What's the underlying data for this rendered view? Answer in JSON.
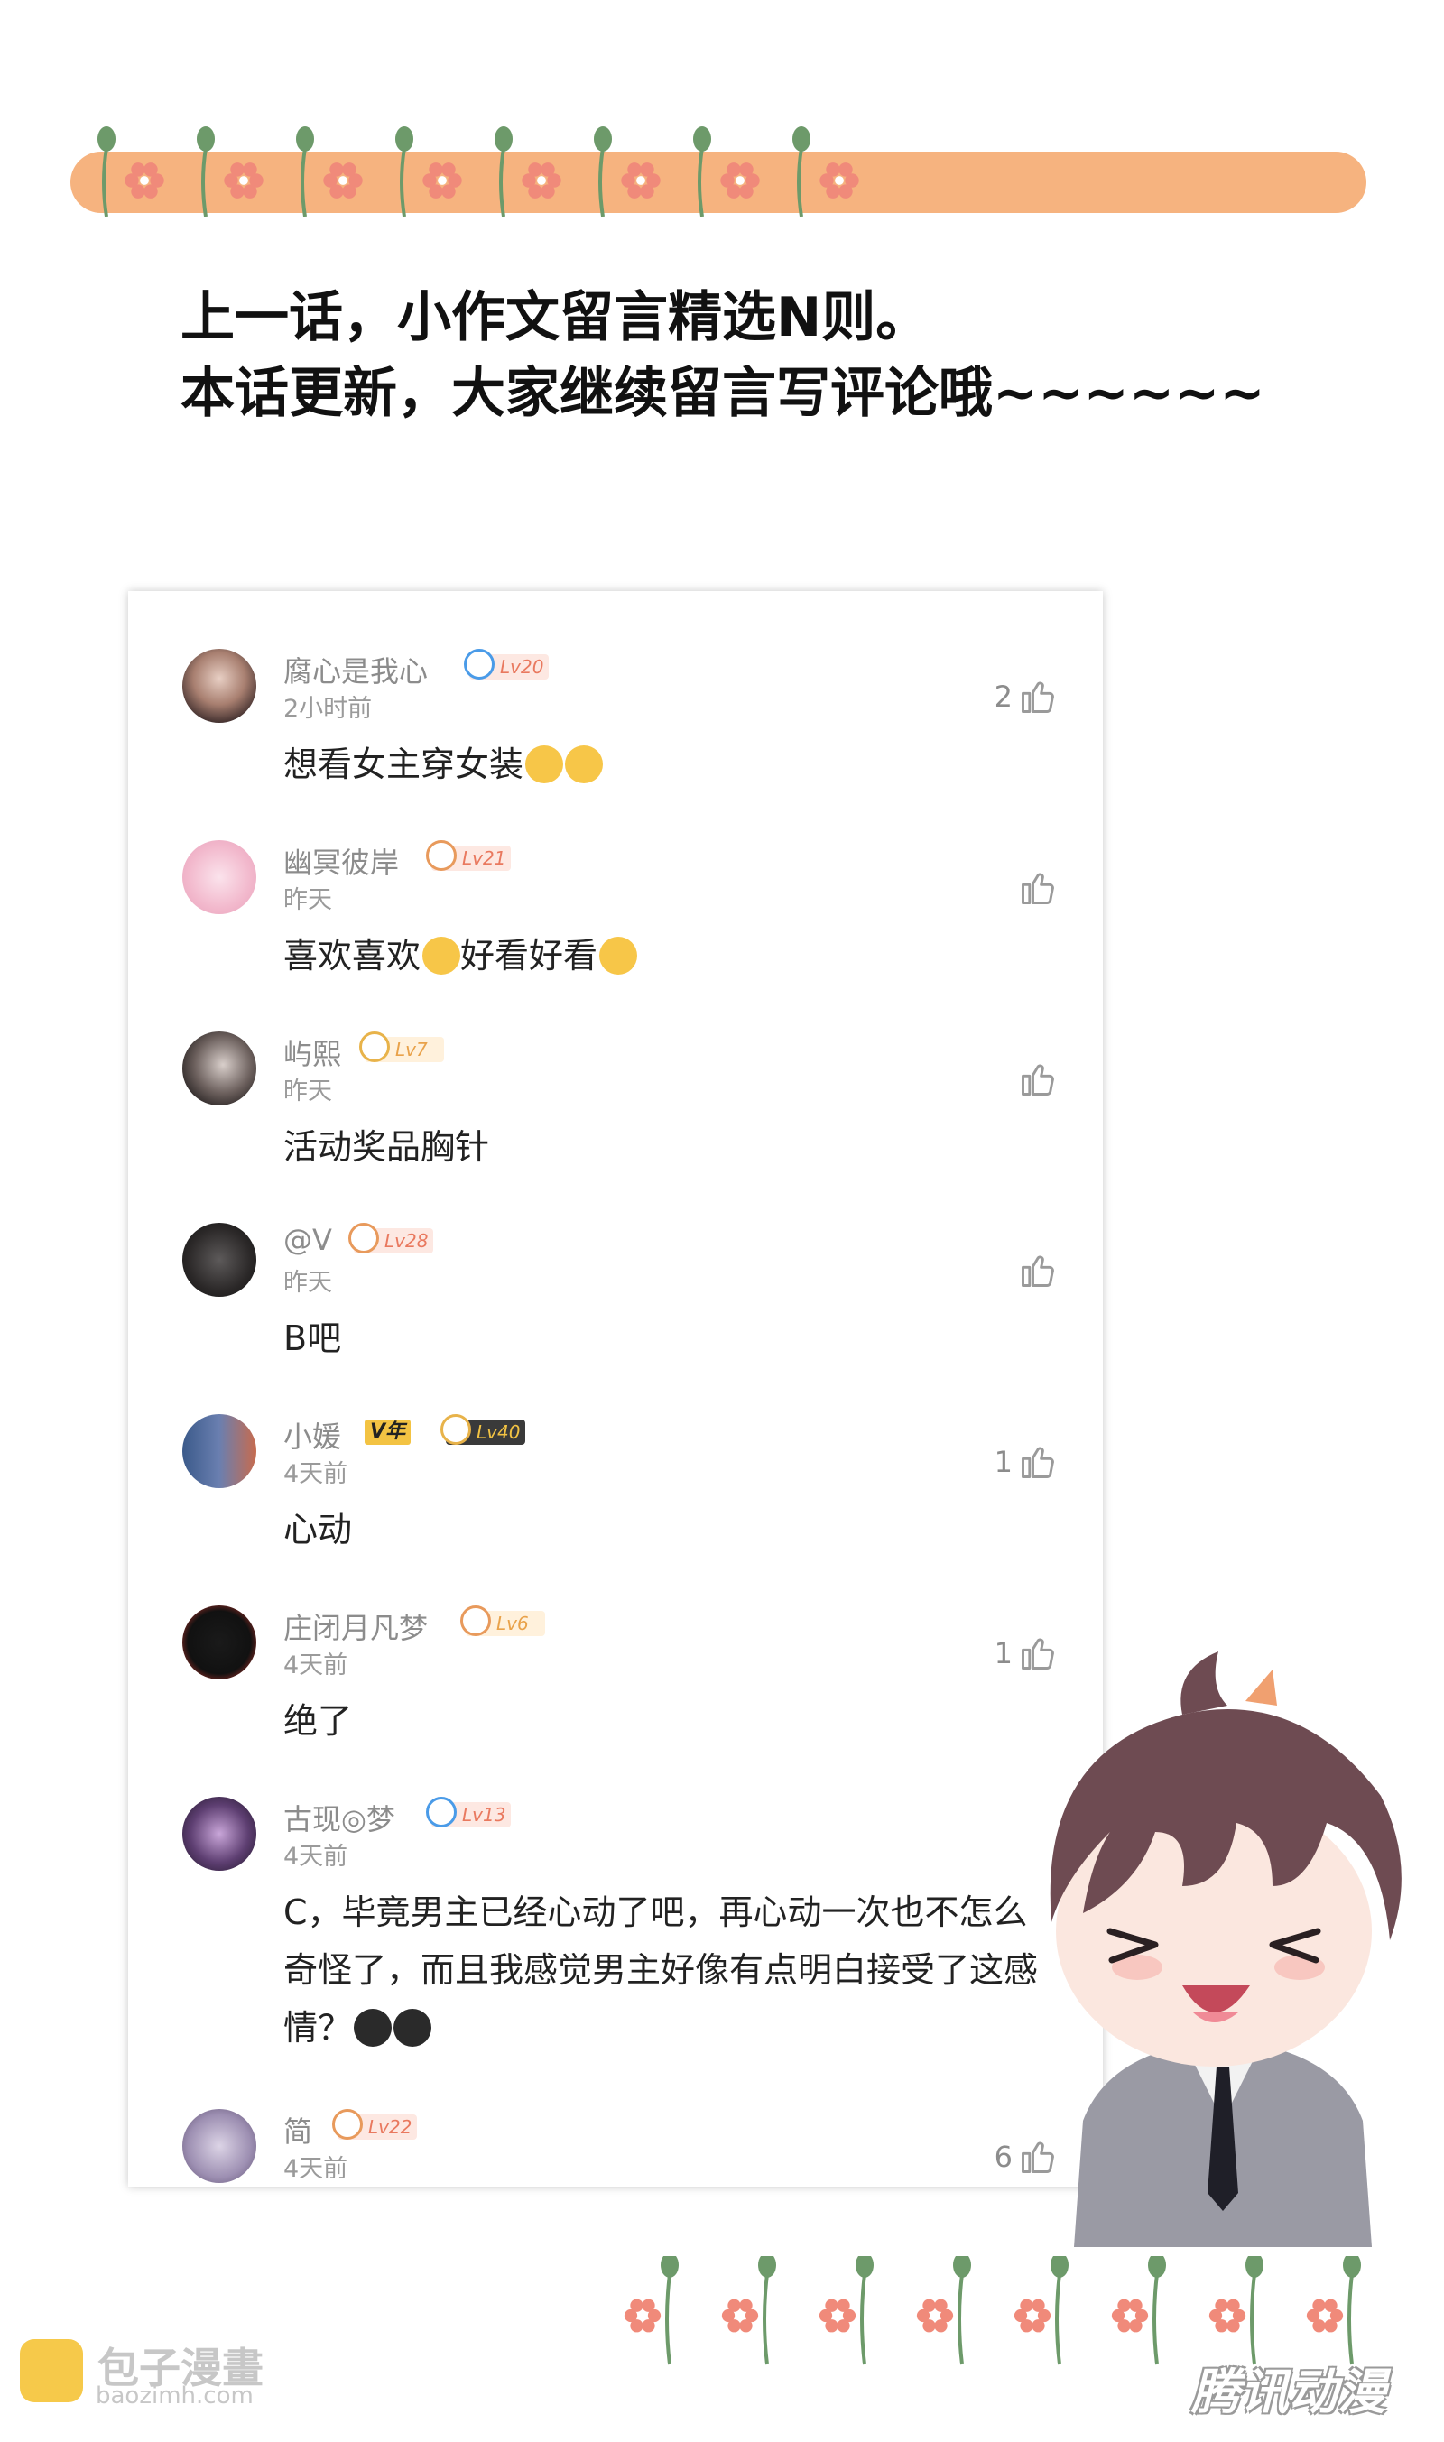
{
  "headline": {
    "line1": "上一话，小作文留言精选N则。",
    "line2": "本话更新，大家继续留言写评论哦~~~~~~"
  },
  "colors": {
    "bar": "#f6b37f",
    "flower": "#f08a7a",
    "leaf": "#6d9a6a"
  },
  "comments": [
    {
      "name": "腐心是我心",
      "level": "Lv20",
      "time": "2小时前",
      "text": "想看女主穿女装",
      "emoji": [
        "face-icon",
        "face-icon"
      ],
      "likes": "2"
    },
    {
      "name": "幽冥彼岸",
      "level": "Lv21",
      "time": "昨天",
      "text_a": "喜欢喜欢",
      "text_b": "好看好看",
      "likes": ""
    },
    {
      "name": "屿熙",
      "level": "Lv7",
      "time": "昨天",
      "text": "活动奖品胸针",
      "likes": ""
    },
    {
      "name": "@V",
      "level": "Lv28",
      "time": "昨天",
      "text": "B吧",
      "likes": ""
    },
    {
      "name": "小媛",
      "vip": "V年",
      "level": "Lv40",
      "time": "4天前",
      "text": "心动",
      "likes": "1"
    },
    {
      "name": "庄闭月凡梦",
      "level": "Lv6",
      "time": "4天前",
      "text": "绝了",
      "likes": "1"
    },
    {
      "name": "古现◎梦",
      "level": "Lv13",
      "time": "4天前",
      "text": "C，毕竟男主已经心动了吧，再心动一次也不怎么奇怪了，而且我感觉男主好像有点明白接受了这感情？",
      "likes": ""
    },
    {
      "name": "简",
      "level": "Lv22",
      "time": "4天前",
      "likes": "6"
    }
  ],
  "watermark_left": {
    "title": "包子漫畫",
    "url": "baozimh.com"
  },
  "watermark_right": "腾讯动漫"
}
